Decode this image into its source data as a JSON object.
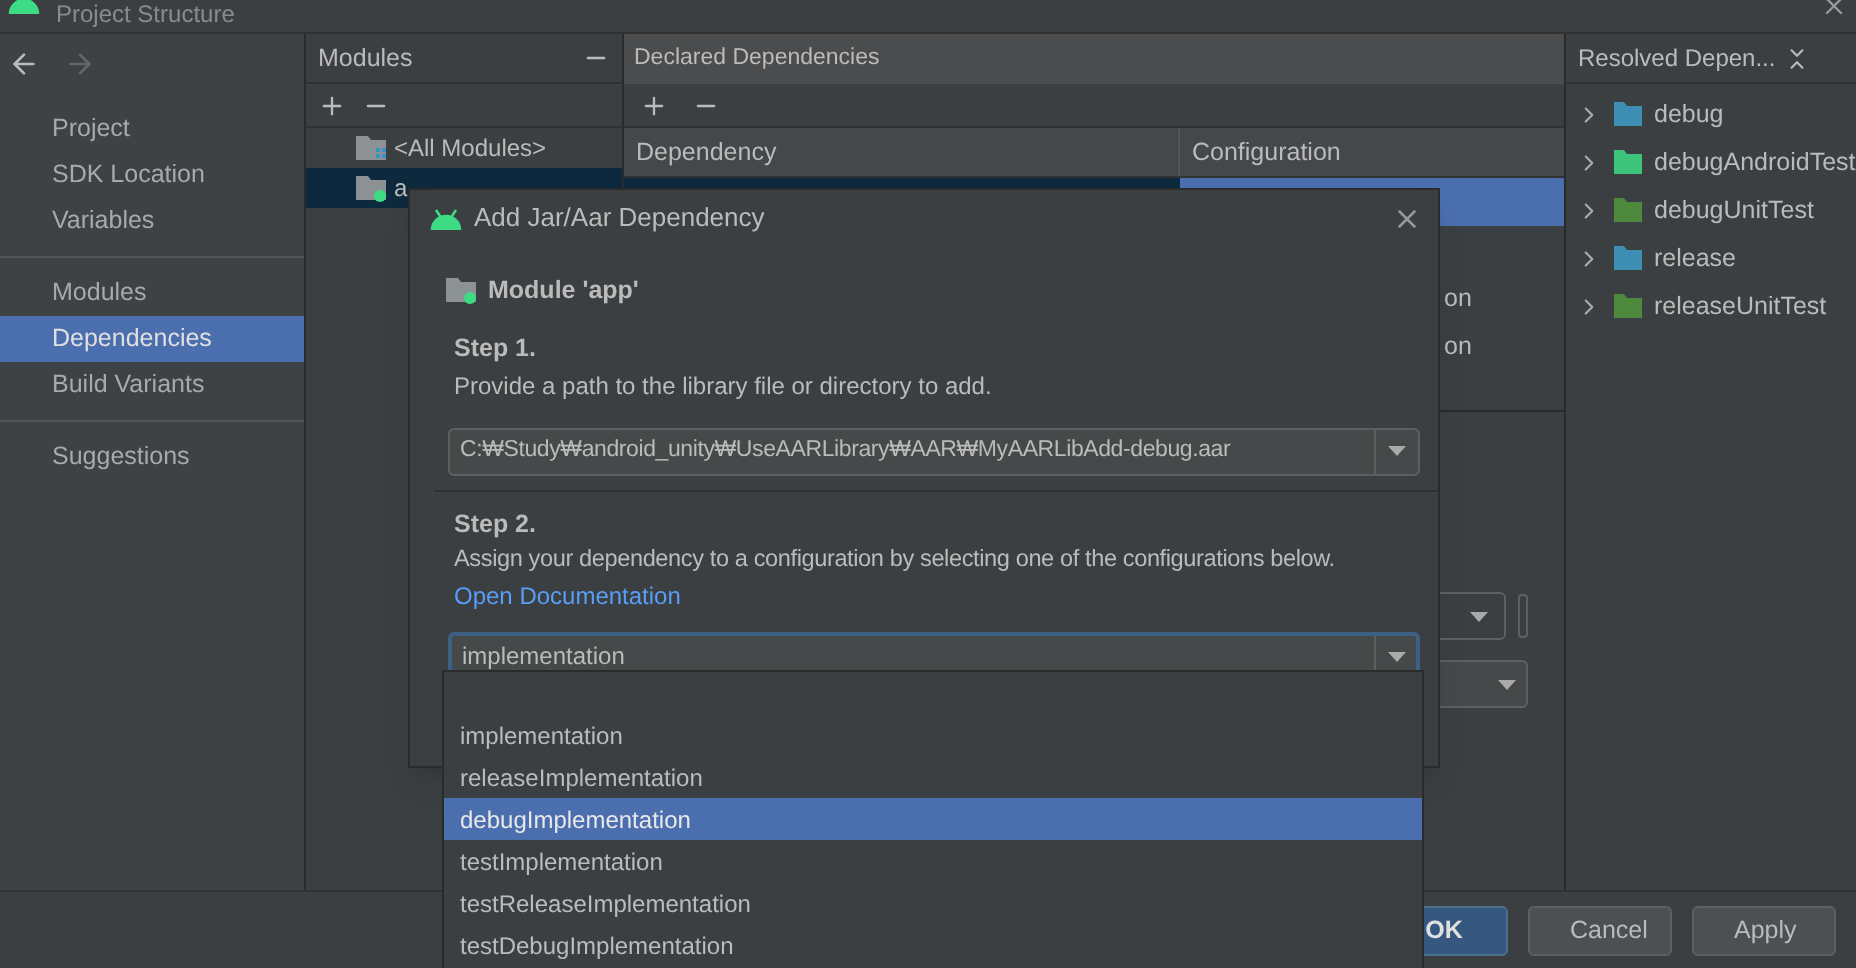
{
  "window": {
    "title": "Project Structure"
  },
  "sidebar": {
    "groups": [
      [
        {
          "label": "Project",
          "selected": false
        },
        {
          "label": "SDK Location",
          "selected": false
        },
        {
          "label": "Variables",
          "selected": false
        }
      ],
      [
        {
          "label": "Modules",
          "selected": false
        },
        {
          "label": "Dependencies",
          "selected": true
        },
        {
          "label": "Build Variants",
          "selected": false
        }
      ],
      [
        {
          "label": "Suggestions",
          "selected": false
        }
      ]
    ]
  },
  "modules": {
    "title": "Modules",
    "items": [
      {
        "label": "<All Modules>",
        "kind": "all",
        "selected": false
      },
      {
        "label": "a",
        "kind": "module",
        "selected": true
      }
    ]
  },
  "declared": {
    "title": "Declared Dependencies",
    "columns": [
      "Dependency",
      "Configuration"
    ],
    "rows": [
      {
        "selected": true
      },
      {
        "configuration": "on",
        "selected": false
      },
      {
        "configuration": "on",
        "selected": false
      }
    ]
  },
  "resolved": {
    "title": "Resolved Depen...",
    "items": [
      {
        "label": "debug",
        "color": "#3d8fb3"
      },
      {
        "label": "debugAndroidTest",
        "color": "#3dc47a"
      },
      {
        "label": "debugUnitTest",
        "color": "#4e8a3e"
      },
      {
        "label": "release",
        "color": "#3d8fb3"
      },
      {
        "label": "releaseUnitTest",
        "color": "#4e8a3e"
      }
    ]
  },
  "dialog": {
    "title": "Add Jar/Aar Dependency",
    "module": "Module 'app'",
    "step1": {
      "heading": "Step 1.",
      "text": "Provide a path to the library file or directory to add.",
      "path": "C:₩Study₩android_unity₩UseAARLibrary₩AAR₩MyAARLibAdd-debug.aar"
    },
    "step2": {
      "heading": "Step 2.",
      "text": "Assign your dependency to a configuration by selecting one of the configurations below.",
      "link": "Open Documentation",
      "value": "implementation"
    }
  },
  "popup": {
    "items": [
      {
        "label": "implementation",
        "selected": false
      },
      {
        "label": "releaseImplementation",
        "selected": false
      },
      {
        "label": "debugImplementation",
        "selected": true
      },
      {
        "label": "testImplementation",
        "selected": false
      },
      {
        "label": "testReleaseImplementation",
        "selected": false
      },
      {
        "label": "testDebugImplementation",
        "selected": false
      }
    ]
  },
  "buttons": [
    {
      "label": "OK",
      "kind": "primary"
    },
    {
      "label": "Cancel",
      "kind": "normal"
    },
    {
      "label": "Apply",
      "kind": "normal"
    }
  ]
}
